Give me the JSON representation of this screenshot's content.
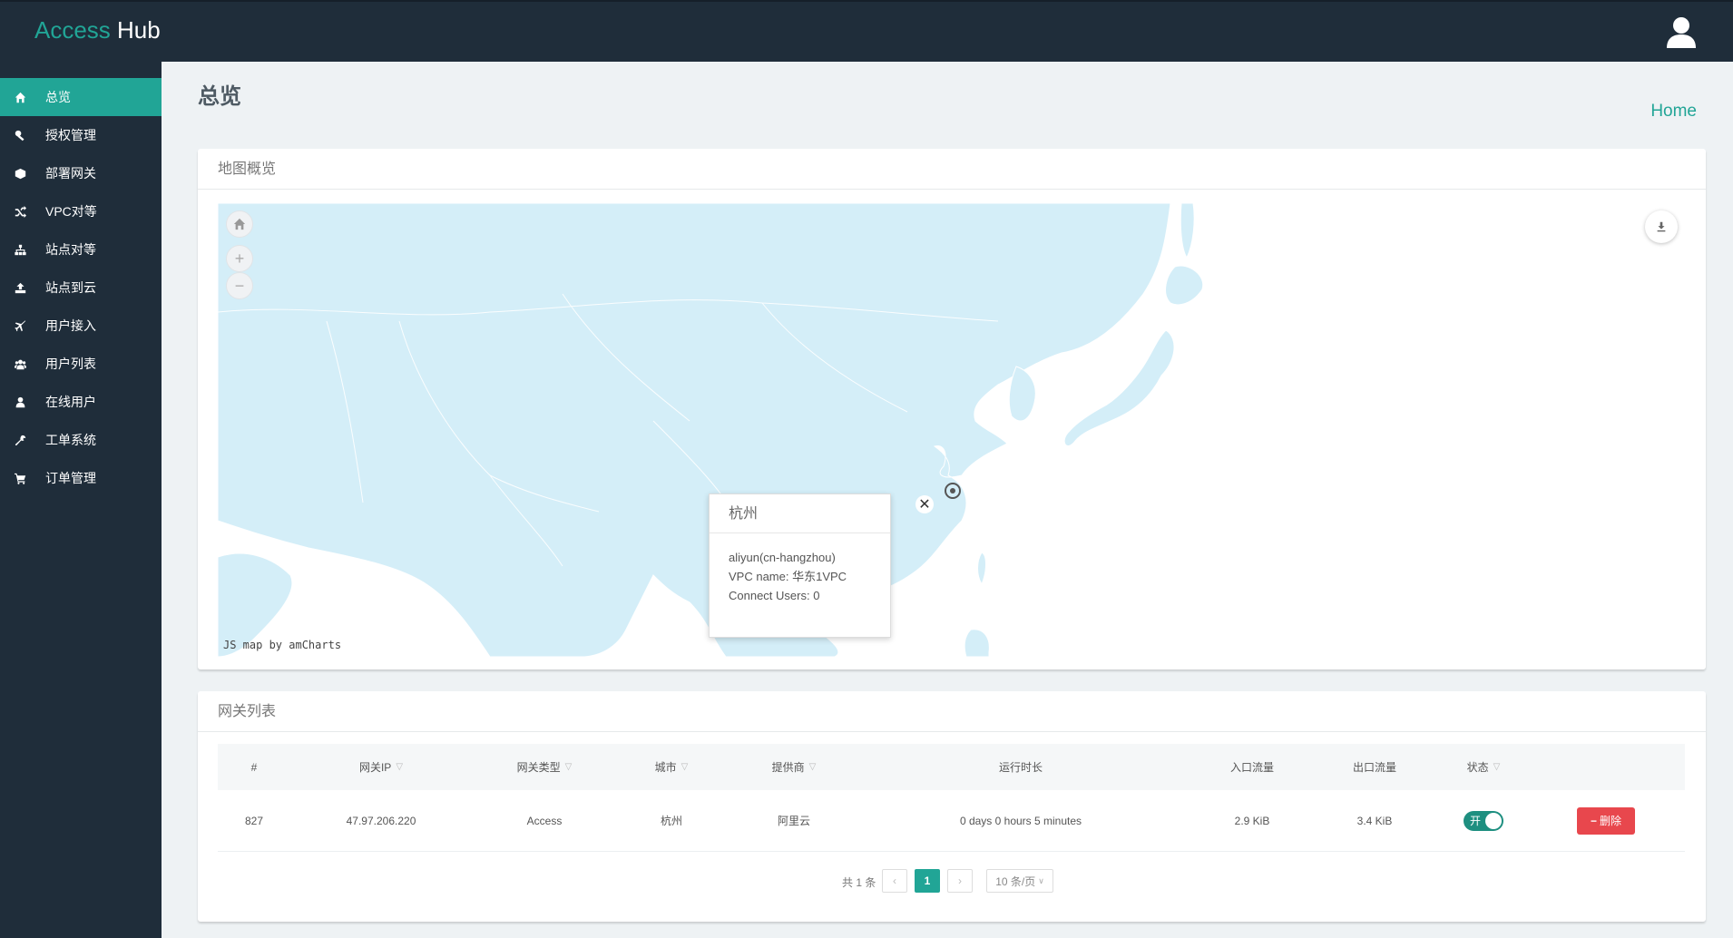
{
  "header": {
    "brand_part1": "Access ",
    "brand_part2": "Hub",
    "user_icon": "user-icon"
  },
  "sidebar": {
    "items": [
      {
        "label": "总览",
        "icon": "home-icon",
        "active": true
      },
      {
        "label": "授权管理",
        "icon": "key-icon",
        "active": false
      },
      {
        "label": "部署网关",
        "icon": "cube-icon",
        "active": false
      },
      {
        "label": "VPC对等",
        "icon": "shuffle-icon",
        "active": false
      },
      {
        "label": "站点对等",
        "icon": "sitemap-icon",
        "active": false
      },
      {
        "label": "站点到云",
        "icon": "upload-icon",
        "active": false
      },
      {
        "label": "用户接入",
        "icon": "plane-icon",
        "active": false
      },
      {
        "label": "用户列表",
        "icon": "users-icon",
        "active": false
      },
      {
        "label": "在线用户",
        "icon": "user-icon",
        "active": false
      },
      {
        "label": "工单系统",
        "icon": "wrench-icon",
        "active": false
      },
      {
        "label": "订单管理",
        "icon": "cart-icon",
        "active": false
      }
    ]
  },
  "page": {
    "title": "总览",
    "breadcrumb": "Home"
  },
  "map_panel": {
    "title": "地图概览",
    "credit": "JS map by amCharts",
    "popup": {
      "title": "杭州",
      "provider_line": "aliyun(cn-hangzhou)",
      "vpc_line": "VPC name: 华东1VPC",
      "users_line": "Connect Users: 0"
    }
  },
  "gateway_panel": {
    "title": "网关列表",
    "columns": [
      {
        "label": "#",
        "filter": false
      },
      {
        "label": "网关IP",
        "filter": true
      },
      {
        "label": "网关类型",
        "filter": true
      },
      {
        "label": "城市",
        "filter": true
      },
      {
        "label": "提供商",
        "filter": true
      },
      {
        "label": "运行时长",
        "filter": false
      },
      {
        "label": "入口流量",
        "filter": false
      },
      {
        "label": "出口流量",
        "filter": false
      },
      {
        "label": "状态",
        "filter": true
      },
      {
        "label": "",
        "filter": false
      }
    ],
    "rows": [
      {
        "id": "827",
        "ip": "47.97.206.220",
        "type": "Access",
        "city": "杭州",
        "provider": "阿里云",
        "uptime": "0 days 0 hours 5 minutes",
        "in_traffic": "2.9 KiB",
        "out_traffic": "3.4 KiB",
        "status_label": "开",
        "status_on": true,
        "delete_label": "删除"
      }
    ],
    "pagination": {
      "total": "共 1 条",
      "prev": "‹",
      "current": "1",
      "next": "›",
      "page_size": "10 条/页"
    }
  },
  "colors": {
    "accent": "#21a596",
    "sidebar_bg": "#1f2d3a",
    "danger": "#e8474d",
    "map_land": "#d4eef8"
  }
}
